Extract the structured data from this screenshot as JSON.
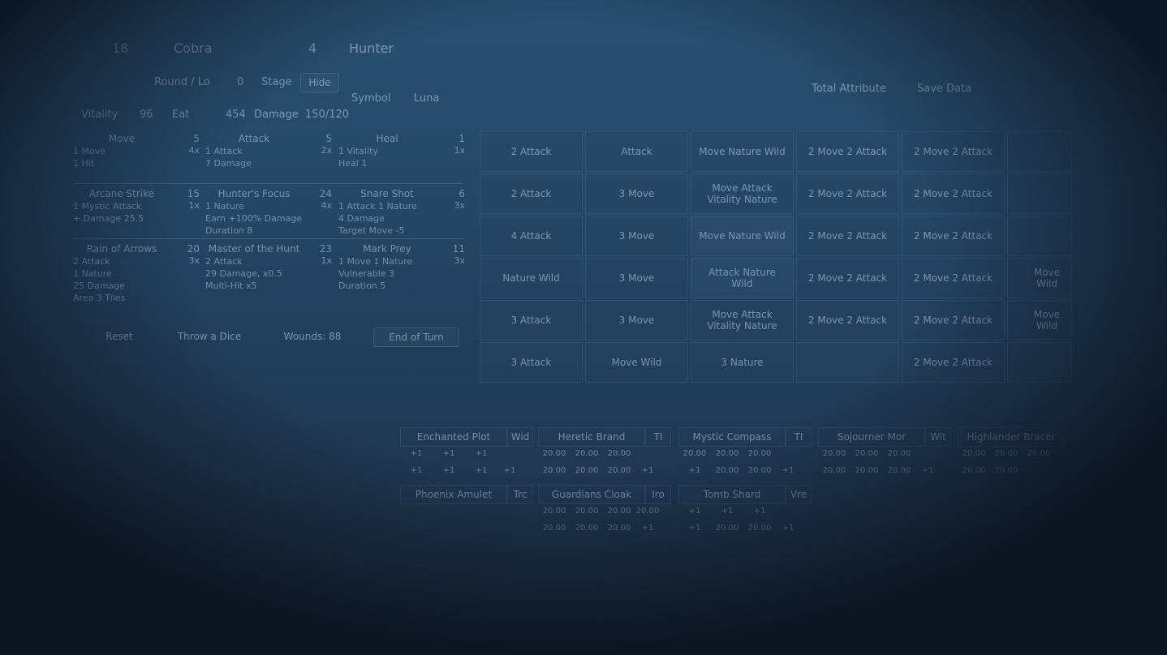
{
  "header": {
    "char_level": "18",
    "class_name": "Cobra",
    "ally_level": "4",
    "ally_name": "Hunter",
    "faint_title": "",
    "row2_a": "Round / Lo",
    "row2_b": "0",
    "row2_c": "Stage",
    "row2_d": "Hide",
    "symbol_label": "Symbol",
    "symbol_value": "Luna",
    "right_a": "Total Attribute",
    "right_b": "Save Data",
    "stat_a_label": "Vitality",
    "stat_a_value": "96",
    "stat_b_label": "Eat",
    "stat_b_value": "454",
    "stat_c_label": "Damage",
    "stat_c_value": "150/120"
  },
  "skills": [
    {
      "name": "Move",
      "cost": "5",
      "level": "4x",
      "lines": [
        "1 Move",
        "1 Hit"
      ]
    },
    {
      "name": "Attack",
      "cost": "5",
      "level": "2x",
      "lines": [
        "1 Attack",
        "7 Damage"
      ]
    },
    {
      "name": "Heal",
      "cost": "1",
      "level": "1x",
      "lines": [
        "1 Vitality",
        "Heal 1"
      ]
    },
    {
      "name": "Arcane Strike",
      "cost": "15",
      "level": "1x",
      "lines": [
        "1 Mystic Attack",
        "+ Damage 25.5"
      ]
    },
    {
      "name": "Hunter's Focus",
      "cost": "24",
      "level": "4x",
      "lines": [
        "1 Nature",
        "Earn +100% Damage",
        "Duration 8"
      ]
    },
    {
      "name": "Snare Shot",
      "cost": "6",
      "level": "3x",
      "lines": [
        "1 Attack 1 Nature",
        "4 Damage",
        "Target Move -5"
      ]
    },
    {
      "name": "Rain of Arrows",
      "cost": "20",
      "level": "3x",
      "lines": [
        "2 Attack",
        "1 Nature",
        "25 Damage",
        "Area 3 Tiles"
      ]
    },
    {
      "name": "Master of the Hunt",
      "cost": "23",
      "level": "1x",
      "lines": [
        "2 Attack",
        "29 Damage, x0.5",
        "Multi-Hit x5"
      ]
    },
    {
      "name": "Mark Prey",
      "cost": "11",
      "level": "3x",
      "lines": [
        "1 Move 1 Nature",
        "Vulnerable 3",
        "Duration 5"
      ]
    }
  ],
  "buttons": {
    "b1": "Reset",
    "b2": "Throw a Dice",
    "b3": "Wounds: 88",
    "b4": "End of Turn"
  },
  "cards": [
    [
      "2 Attack",
      "Attack",
      "Move Nature Wild",
      "2 Move 2 Attack",
      "2 Move 2 Attack"
    ],
    [
      "2 Attack",
      "3 Move",
      "Move Attack Vitality Nature",
      "2 Move 2 Attack",
      "2 Move 2 Attack"
    ],
    [
      "4 Attack",
      "3 Move",
      "Move Nature Wild",
      "2 Move 2 Attack",
      "2 Move 2 Attack"
    ],
    [
      "Nature Wild",
      "3 Move",
      "Attack Nature Wild",
      "2 Move 2 Attack",
      "2 Move 2 Attack"
    ],
    [
      "3 Attack",
      "3 Move",
      "Move Attack Vitality Nature",
      "2 Move 2 Attack",
      "2 Move 2 Attack"
    ],
    [
      "3 Attack",
      "Move Wild",
      "3 Nature",
      "",
      "2 Move 2 Attack"
    ]
  ],
  "cards_right": [
    "",
    "",
    "",
    "Move Wild",
    "Move Wild",
    ""
  ],
  "gear": [
    {
      "name": "Enchanted Plot",
      "tag": "Wid",
      "rows": [
        [
          "+1",
          "+1",
          "+1",
          ""
        ],
        [
          "+1",
          "+1",
          "+1",
          "+1"
        ]
      ]
    },
    {
      "name": "Heretic Brand",
      "tag": "TI",
      "rows": [
        [
          "20.00",
          "20.00",
          "20.00",
          ""
        ],
        [
          "20.00",
          "20.00",
          "20.00",
          "+1"
        ]
      ]
    },
    {
      "name": "Mystic Compass",
      "tag": "TI",
      "rows": [
        [
          "20.00",
          "20.00",
          "20.00",
          ""
        ],
        [
          "+1",
          "20.00",
          "20.00",
          "+1"
        ]
      ]
    },
    {
      "name": "Sojourner Mor",
      "tag": "Wit",
      "rows": [
        [
          "20.00",
          "20.00",
          "20.00",
          ""
        ],
        [
          "20.00",
          "20.00",
          "20.00",
          "+1"
        ]
      ]
    },
    {
      "name": "Highlander Bracer",
      "tag": "",
      "rows": [
        [
          "20.00",
          "20.00",
          "20.00",
          ""
        ],
        [
          "20.00",
          "20.00",
          "",
          ""
        ]
      ]
    },
    {
      "name": "Phoenix Amulet",
      "tag": "Trc",
      "rows": [
        [
          "",
          "",
          "",
          ""
        ]
      ]
    },
    {
      "name": "Guardians Cloak",
      "tag": "Iro",
      "rows": [
        [
          "20.00",
          "20.00",
          "20.00",
          "20.00"
        ],
        [
          "20.00",
          "20.00",
          "20.00",
          "+1"
        ]
      ]
    },
    {
      "name": "Tomb Shard",
      "tag": "Vre",
      "rows": [
        [
          "+1",
          "+1",
          "+1",
          ""
        ],
        [
          "+1",
          "20.00",
          "20.00",
          "+1"
        ]
      ]
    }
  ]
}
